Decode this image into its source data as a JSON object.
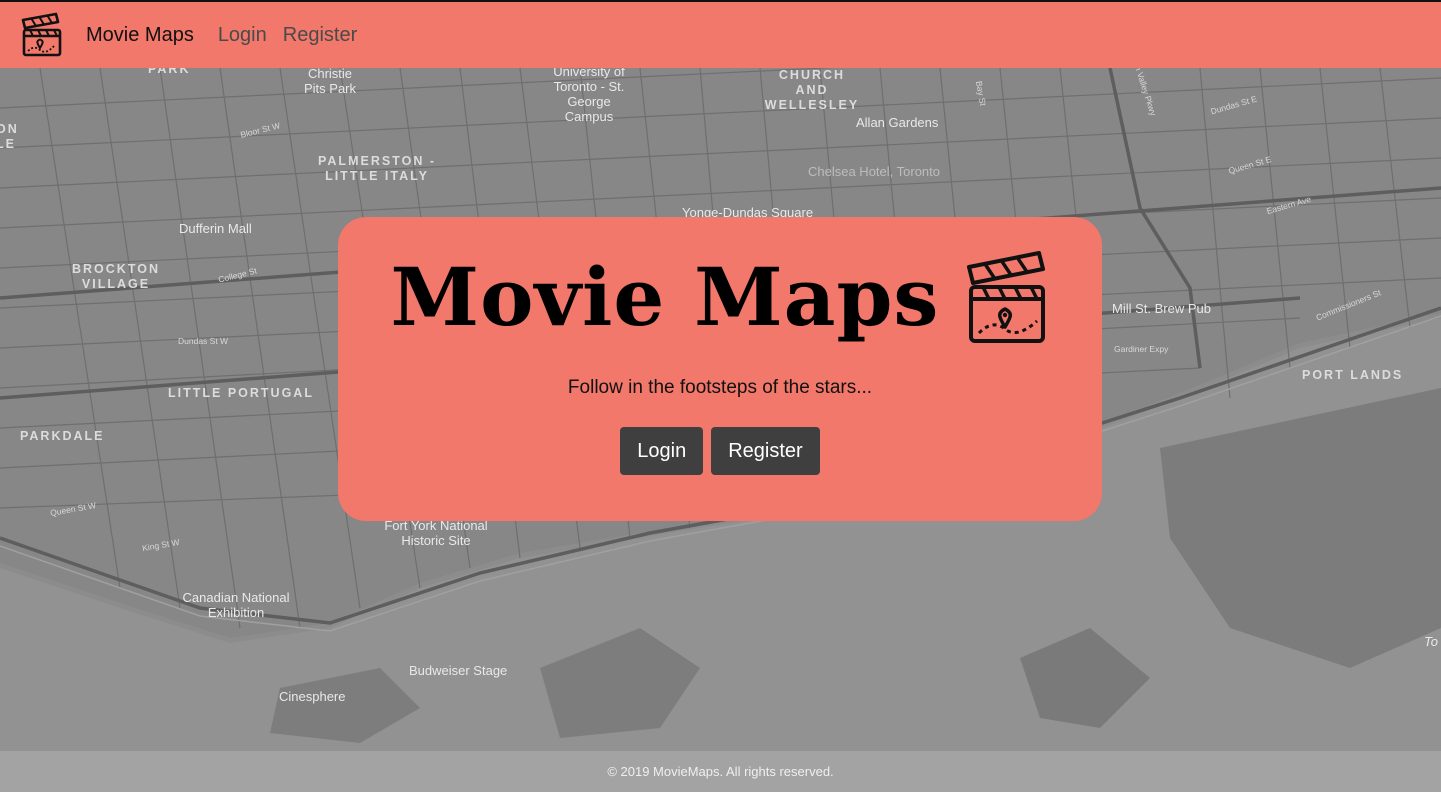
{
  "nav": {
    "logo_icon": "clapperboard-map-icon",
    "brand": "Movie Maps",
    "links": [
      "Login",
      "Register"
    ]
  },
  "hero": {
    "title": "Movie Maps",
    "logo_icon": "clapperboard-map-icon",
    "tagline": "Follow in the footsteps of the stars...",
    "login_label": "Login",
    "register_label": "Register"
  },
  "map": {
    "districts": [
      "PARK",
      "CHURCH AND WELLESLEY",
      "PALMERSTON - LITTLE ITALY",
      "BROCKTON VILLAGE",
      "LITTLE PORTUGAL",
      "PARKDALE",
      "PORT LANDS",
      "ON LE"
    ],
    "places": [
      "Christie Pits Park",
      "University of Toronto - St. George Campus",
      "Allan Gardens",
      "Chelsea Hotel, Toronto",
      "Yonge-Dundas Square",
      "Dufferin Mall",
      "Mill St. Brew Pub",
      "Fort York National Historic Site",
      "Canadian National Exhibition",
      "Budweiser Stage",
      "Cinesphere",
      "To"
    ],
    "streets": [
      "Bloor St W",
      "College St",
      "Dundas St W",
      "Queen St W",
      "King St W",
      "Gardiner Expy",
      "Dundas St E",
      "Queen St E",
      "Eastern Ave",
      "Commissioners St",
      "Bay St",
      "Don Valley Pkwy"
    ]
  },
  "footer": {
    "text": "© 2019 MovieMaps. All rights reserved."
  },
  "colors": {
    "primary": "#f1786a",
    "button": "#3f3f3f",
    "map_bg": "#8c8c8c",
    "footer_bg": "#a3a3a3"
  }
}
